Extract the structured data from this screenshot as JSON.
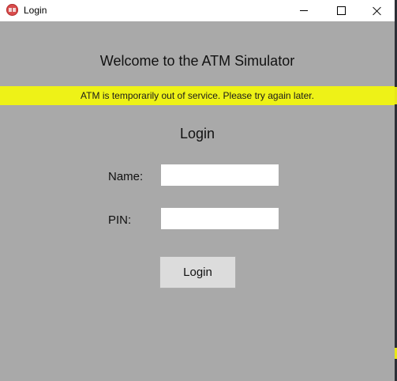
{
  "window": {
    "title": "Login",
    "icon": "atm-app-icon",
    "controls": {
      "minimize": "minimize-icon",
      "maximize": "maximize-icon",
      "close": "close-icon"
    }
  },
  "main": {
    "welcome_text": "Welcome to the ATM Simulator",
    "banner_text": "ATM is temporarily out of service. Please try again later.",
    "banner_color": "#eef217",
    "heading": "Login",
    "name_label": "Name:",
    "name_value": "",
    "pin_label": "PIN:",
    "pin_value": "",
    "login_button_label": "Login"
  },
  "colors": {
    "background": "#a9a9a9",
    "button": "#dcdcdc"
  }
}
